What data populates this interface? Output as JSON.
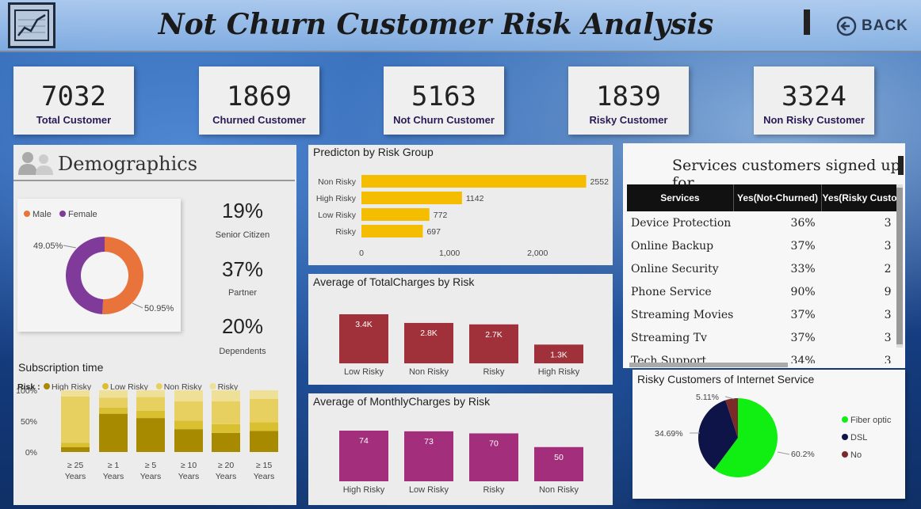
{
  "header": {
    "title": "Not Churn Customer Risk Analysis",
    "back_label": "BACK"
  },
  "kpis": [
    {
      "value": "7032",
      "label": "Total Customer"
    },
    {
      "value": "1869",
      "label": "Churned Customer"
    },
    {
      "value": "5163",
      "label": "Not Churn Customer"
    },
    {
      "value": "1839",
      "label": "Risky Customer"
    },
    {
      "value": "3324",
      "label": "Non Risky Customer"
    }
  ],
  "demographics": {
    "title": "Demographics",
    "stats": [
      {
        "value": "19%",
        "label": "Senior Citizen"
      },
      {
        "value": "37%",
        "label": "Partner"
      },
      {
        "value": "20%",
        "label": "Dependents"
      }
    ]
  },
  "subscription": {
    "title": "Subscription time",
    "legend_prefix": "Risk :"
  },
  "services": {
    "title": "Services customers signed up for",
    "columns": [
      "Services",
      "Yes(Not-Churned)",
      "Yes(Risky Custo"
    ],
    "rows": [
      {
        "service": "Device Protection",
        "not_churned": "36%",
        "risky": "3"
      },
      {
        "service": "Online Backup",
        "not_churned": "37%",
        "risky": "3"
      },
      {
        "service": "Online Security",
        "not_churned": "33%",
        "risky": "2"
      },
      {
        "service": "Phone Service",
        "not_churned": "90%",
        "risky": "9"
      },
      {
        "service": "Streaming Movies",
        "not_churned": "37%",
        "risky": "3"
      },
      {
        "service": "Streaming Tv",
        "not_churned": "37%",
        "risky": "3"
      },
      {
        "service": "Tech Support",
        "not_churned": "34%",
        "risky": "3"
      }
    ]
  },
  "colors": {
    "male": "#e8743b",
    "female": "#7f3a9a",
    "gold": "#f5bd00",
    "crimson": "#a0313a",
    "magenta": "#a32e7b",
    "high_risky": "#a88a00",
    "low_risky": "#d8c030",
    "non_risky": "#e8d060",
    "risky": "#efe098",
    "fiber": "#11ee11",
    "dsl": "#0e1448",
    "no": "#7b2a2a"
  },
  "chart_data": [
    {
      "type": "pie",
      "name": "Gender",
      "series": [
        {
          "name": "Male",
          "value": 50.95
        },
        {
          "name": "Female",
          "value": 49.05
        }
      ],
      "labels": [
        "50.95%",
        "49.05%"
      ],
      "legend": [
        "Male",
        "Female"
      ]
    },
    {
      "type": "bar",
      "orientation": "horizontal",
      "title": "Predicton by Risk Group",
      "categories": [
        "Non Risky",
        "High Risky",
        "Low Risky",
        "Risky"
      ],
      "values": [
        2552,
        1142,
        772,
        697
      ],
      "xticks": [
        "0",
        "1,000",
        "2,000"
      ],
      "xlim": [
        0,
        2700
      ]
    },
    {
      "type": "bar",
      "title": "Average of TotalCharges by Risk",
      "categories": [
        "Low Risky",
        "Non Risky",
        "Risky",
        "High Risky"
      ],
      "values": [
        3400,
        2800,
        2700,
        1300
      ],
      "value_labels": [
        "3.4K",
        "2.8K",
        "2.7K",
        "1.3K"
      ]
    },
    {
      "type": "bar",
      "title": "Average of MonthlyCharges by Risk",
      "categories": [
        "High Risky",
        "Low Risky",
        "Risky",
        "Non Risky"
      ],
      "values": [
        74,
        73,
        70,
        50
      ],
      "value_labels": [
        "74",
        "73",
        "70",
        "50"
      ]
    },
    {
      "type": "bar",
      "stacked": "100%",
      "title": "Subscription time",
      "categories": [
        "≥ 25 Years",
        "≥ 1 Years",
        "≥ 5 Years",
        "≥ 10 Years",
        "≥ 20 Years",
        "≥ 15 Years"
      ],
      "series": [
        {
          "name": "High Risky",
          "values": [
            8,
            62,
            55,
            37,
            31,
            34
          ]
        },
        {
          "name": "Low Risky",
          "values": [
            7,
            10,
            12,
            14,
            14,
            14
          ]
        },
        {
          "name": "Non Risky",
          "values": [
            75,
            16,
            22,
            31,
            37,
            38
          ]
        },
        {
          "name": "Risky",
          "values": [
            10,
            12,
            11,
            18,
            18,
            14
          ]
        }
      ],
      "yticks": [
        "0%",
        "50%",
        "100%"
      ],
      "ylim": [
        0,
        100
      ]
    },
    {
      "type": "pie",
      "title": "Risky Customers of Internet Service",
      "series": [
        {
          "name": "Fiber optic",
          "value": 60.2
        },
        {
          "name": "DSL",
          "value": 34.69
        },
        {
          "name": "No",
          "value": 5.11
        }
      ],
      "labels": [
        "60.2%",
        "34.69%",
        "5.11%"
      ],
      "legend": [
        "Fiber optic",
        "DSL",
        "No"
      ]
    }
  ]
}
